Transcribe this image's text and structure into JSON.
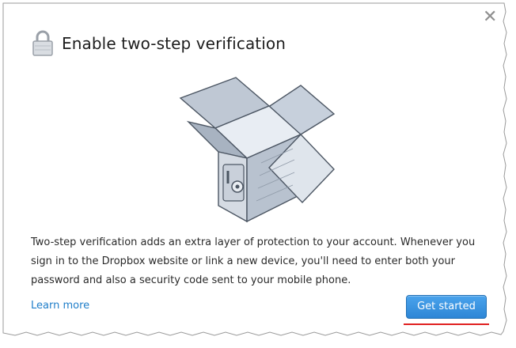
{
  "dialog": {
    "title": "Enable two-step verification",
    "description": "Two-step verification adds an extra layer of protection to your account. Whenever you sign in to the Dropbox website or link a new device, you'll need to enter both your password and also a security code sent to your mobile phone.",
    "learn_more_label": "Learn more",
    "primary_button_label": "Get started",
    "close_glyph": "✕"
  },
  "icons": {
    "header": "lock-icon",
    "close": "close-icon",
    "illustration": "open-box-safe-illustration"
  },
  "colors": {
    "link": "#1f7ec9",
    "button": "#2e86d6",
    "annotation": "#e02020"
  }
}
